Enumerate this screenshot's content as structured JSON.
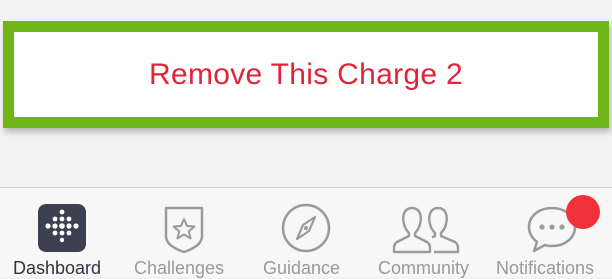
{
  "remove_button": {
    "label": "Remove This Charge 2"
  },
  "tabs": [
    {
      "label": "Dashboard",
      "icon": "dashboard-grid-icon",
      "active": true
    },
    {
      "label": "Challenges",
      "icon": "star-badge-icon",
      "active": false
    },
    {
      "label": "Guidance",
      "icon": "compass-icon",
      "active": false
    },
    {
      "label": "Community",
      "icon": "people-icon",
      "active": false
    },
    {
      "label": "Notifications",
      "icon": "chat-bubble-icon",
      "active": false
    }
  ],
  "colors": {
    "highlight_border": "#6fb517",
    "remove_text": "#e0243a",
    "badge": "#f0323a",
    "active_tab": "#2f3440",
    "inactive_tab": "#9a9a9a"
  }
}
